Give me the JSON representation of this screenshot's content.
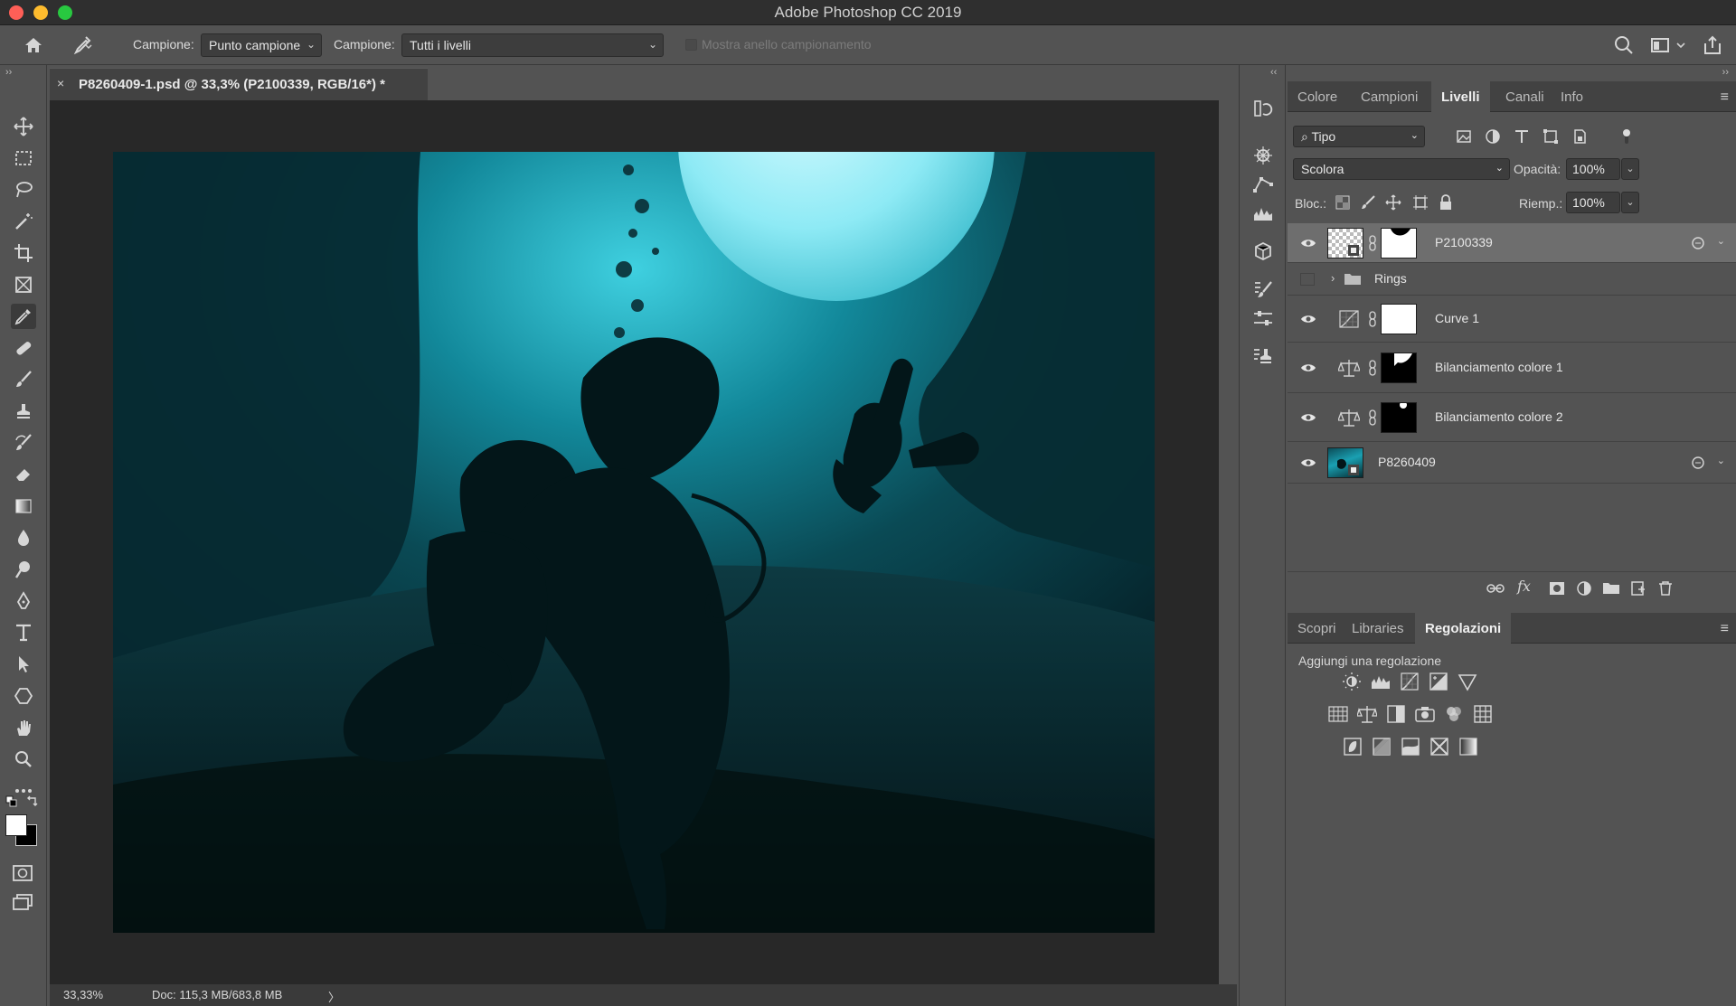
{
  "window": {
    "title": "Adobe Photoshop CC 2019"
  },
  "options_bar": {
    "sample_label_1": "Campione:",
    "sample_value_1": "Punto campione",
    "sample_label_2": "Campione:",
    "sample_value_2": "Tutti i livelli",
    "show_ring_label": "Mostra anello campionamento"
  },
  "document": {
    "tab_title": "P8260409-1.psd @ 33,3% (P2100339, RGB/16*) *",
    "close_glyph": "×"
  },
  "status_bar": {
    "zoom": "33,33%",
    "doc_size": "Doc: 115,3 MB/683,8 MB",
    "arrow": "〉"
  },
  "panel_top": {
    "tabs": [
      "Colore",
      "Campioni",
      "Livelli",
      "Canali",
      "Info"
    ],
    "active_tab": "Livelli",
    "filter_value": "Tipo",
    "blend_mode": "Scolora",
    "opacity_label": "Opacità:",
    "opacity_value": "100%",
    "lock_label": "Bloc.:",
    "fill_label": "Riemp.:",
    "fill_value": "100%"
  },
  "layers": [
    {
      "name": "P2100339",
      "visible": true,
      "selected": true,
      "kind": "smart-with-mask"
    },
    {
      "name": "Rings",
      "visible": false,
      "selected": false,
      "kind": "group"
    },
    {
      "name": "Curve 1",
      "visible": true,
      "selected": false,
      "kind": "curves"
    },
    {
      "name": "Bilanciamento colore 1",
      "visible": true,
      "selected": false,
      "kind": "color-balance"
    },
    {
      "name": "Bilanciamento colore 2",
      "visible": true,
      "selected": false,
      "kind": "color-balance"
    },
    {
      "name": "P8260409",
      "visible": true,
      "selected": false,
      "kind": "smart"
    }
  ],
  "panel_bottom": {
    "tabs": [
      "Scopri",
      "Libraries",
      "Regolazioni"
    ],
    "active_tab": "Regolazioni",
    "add_adjustment_label": "Aggiungi una regolazione"
  },
  "icons": {
    "toolbar": [
      "move-icon",
      "marquee-icon",
      "lasso-icon",
      "magic-wand-icon",
      "crop-icon",
      "frame-icon",
      "eyedropper-icon",
      "healing-icon",
      "brush-icon",
      "stamp-icon",
      "history-brush-icon",
      "eraser-icon",
      "gradient-icon",
      "blur-icon",
      "dodge-icon",
      "pen-icon",
      "type-icon",
      "path-select-icon",
      "shape-icon",
      "hand-icon",
      "zoom-icon",
      "more-icon"
    ]
  },
  "colors": {
    "accent_selected_layer": "#6e6e6e",
    "foreground_color": "#ffffff",
    "background_color": "#000000"
  }
}
